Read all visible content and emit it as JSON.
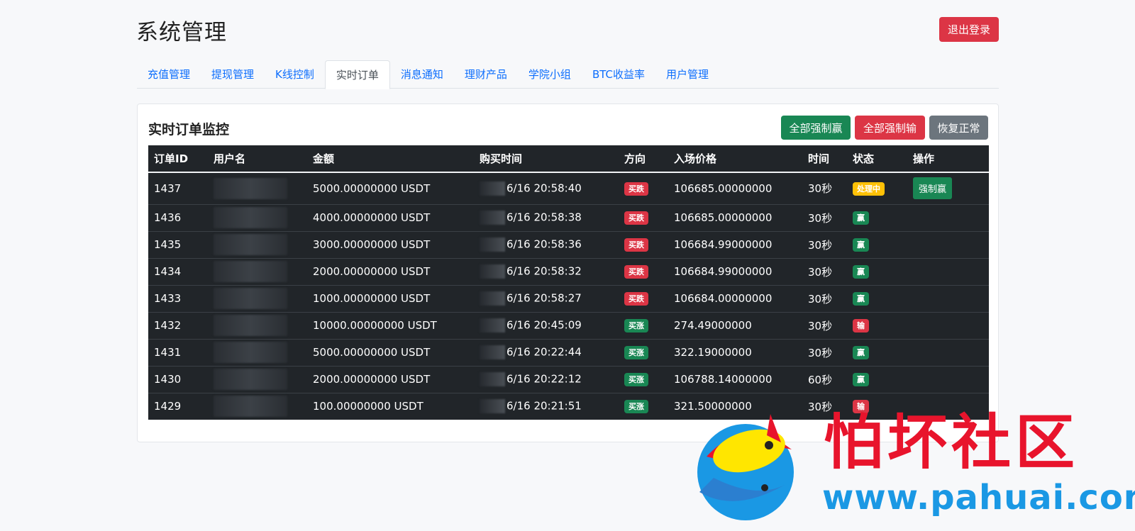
{
  "header": {
    "title": "系统管理",
    "logout_label": "退出登录"
  },
  "tabs": [
    {
      "label": "充值管理",
      "active": false
    },
    {
      "label": "提现管理",
      "active": false
    },
    {
      "label": "K线控制",
      "active": false
    },
    {
      "label": "实时订单",
      "active": true
    },
    {
      "label": "消息通知",
      "active": false
    },
    {
      "label": "理财产品",
      "active": false
    },
    {
      "label": "学院小组",
      "active": false
    },
    {
      "label": "BTC收益率",
      "active": false
    },
    {
      "label": "用户管理",
      "active": false
    }
  ],
  "panel": {
    "title": "实时订单监控",
    "force_win_all_label": "全部强制赢",
    "force_lose_all_label": "全部强制输",
    "restore_label": "恢复正常"
  },
  "table": {
    "columns": [
      "订单ID",
      "用户名",
      "金额",
      "购买时间",
      "方向",
      "入场价格",
      "时间",
      "状态",
      "操作"
    ],
    "rows": [
      {
        "id": "1437",
        "amount": "5000.00000000 USDT",
        "time": "6/16 20:58:40",
        "direction": "买跌",
        "price": "106685.00000000",
        "duration": "30秒",
        "status": "处理中",
        "action": "强制赢"
      },
      {
        "id": "1436",
        "amount": "4000.00000000 USDT",
        "time": "6/16 20:58:38",
        "direction": "买跌",
        "price": "106685.00000000",
        "duration": "30秒",
        "status": "赢",
        "action": ""
      },
      {
        "id": "1435",
        "amount": "3000.00000000 USDT",
        "time": "6/16 20:58:36",
        "direction": "买跌",
        "price": "106684.99000000",
        "duration": "30秒",
        "status": "赢",
        "action": ""
      },
      {
        "id": "1434",
        "amount": "2000.00000000 USDT",
        "time": "6/16 20:58:32",
        "direction": "买跌",
        "price": "106684.99000000",
        "duration": "30秒",
        "status": "赢",
        "action": ""
      },
      {
        "id": "1433",
        "amount": "1000.00000000 USDT",
        "time": "6/16 20:58:27",
        "direction": "买跌",
        "price": "106684.00000000",
        "duration": "30秒",
        "status": "赢",
        "action": ""
      },
      {
        "id": "1432",
        "amount": "10000.00000000 USDT",
        "time": "6/16 20:45:09",
        "direction": "买涨",
        "price": "274.49000000",
        "duration": "30秒",
        "status": "输",
        "action": ""
      },
      {
        "id": "1431",
        "amount": "5000.00000000 USDT",
        "time": "6/16 20:22:44",
        "direction": "买涨",
        "price": "322.19000000",
        "duration": "30秒",
        "status": "赢",
        "action": ""
      },
      {
        "id": "1430",
        "amount": "2000.00000000 USDT",
        "time": "6/16 20:22:12",
        "direction": "买涨",
        "price": "106788.14000000",
        "duration": "60秒",
        "status": "赢",
        "action": ""
      },
      {
        "id": "1429",
        "amount": "100.00000000 USDT",
        "time": "6/16 20:21:51",
        "direction": "买涨",
        "price": "321.50000000",
        "duration": "30秒",
        "status": "输",
        "action": ""
      }
    ]
  },
  "watermark": {
    "title": "怕坏社区",
    "url": "www.pahuai.com"
  },
  "colors": {
    "danger": "#dc3545",
    "success": "#198754",
    "warning": "#ffc107",
    "secondary": "#6c757d",
    "link": "#0d6efd",
    "table_dark": "#212529"
  }
}
